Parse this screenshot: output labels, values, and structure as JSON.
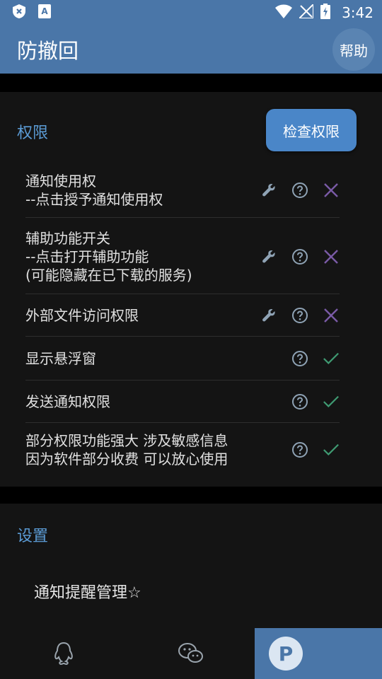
{
  "status_bar": {
    "time": "3:42",
    "icons": [
      "shield-x-icon",
      "font-a-icon",
      "wifi-icon",
      "no-signal-icon",
      "battery-charging-icon"
    ]
  },
  "app_bar": {
    "title": "防撤回",
    "help_label": "帮助"
  },
  "permissions": {
    "section_title": "权限",
    "check_button_label": "检查权限",
    "items": [
      {
        "label": "通知使用权\n--点击授予通知使用权",
        "has_wrench": true,
        "status": "denied"
      },
      {
        "label": "辅助功能开关\n--点击打开辅助功能\n(可能隐藏在已下载的服务)",
        "has_wrench": true,
        "status": "denied"
      },
      {
        "label": "外部文件访问权限",
        "has_wrench": true,
        "status": "denied"
      },
      {
        "label": "显示悬浮窗",
        "has_wrench": false,
        "status": "granted"
      },
      {
        "label": "发送通知权限",
        "has_wrench": false,
        "status": "granted"
      },
      {
        "label": "部分权限功能强大 涉及敏感信息\n因为软件部分收费 可以放心使用",
        "has_wrench": false,
        "status": "granted"
      }
    ]
  },
  "settings": {
    "section_title": "设置",
    "item_label": "通知提醒管理☆"
  },
  "bottom_nav": {
    "icons": [
      "qq-icon",
      "wechat-icon"
    ]
  },
  "colors": {
    "accent": "#4a76a8",
    "section_title": "#5b9bd5",
    "denied": "#7a5aa6",
    "granted": "#3f9a72",
    "icon_gray": "#8fa3b5"
  }
}
